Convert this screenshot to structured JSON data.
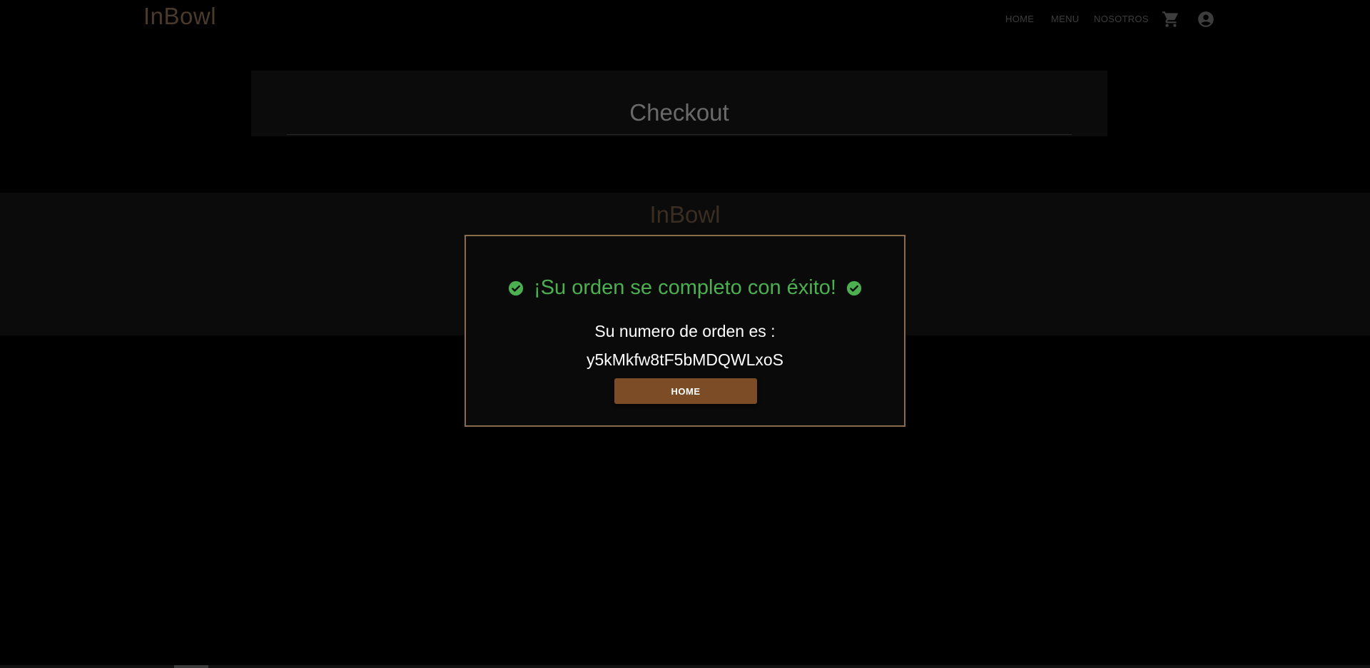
{
  "header": {
    "brand": "InBowl",
    "nav": {
      "home": "HOME",
      "menu": "MENU",
      "nosotros": "NOSOTROS"
    },
    "icons": [
      "cart-icon",
      "account-icon"
    ]
  },
  "checkout": {
    "title": "Checkout"
  },
  "band": {
    "brand": "InBowl"
  },
  "modal": {
    "success_message": "¡Su orden se completo con éxito!",
    "order_label": "Su numero de orden es :",
    "order_number": "y5kMkfw8tF5bMDQWLxoS",
    "home_button": "HOME"
  },
  "colors": {
    "background": "#000000",
    "brand": "#4a3a2b",
    "success": "#4caf50",
    "modal_border": "#8a6b4a",
    "button": "#7b4c25"
  }
}
